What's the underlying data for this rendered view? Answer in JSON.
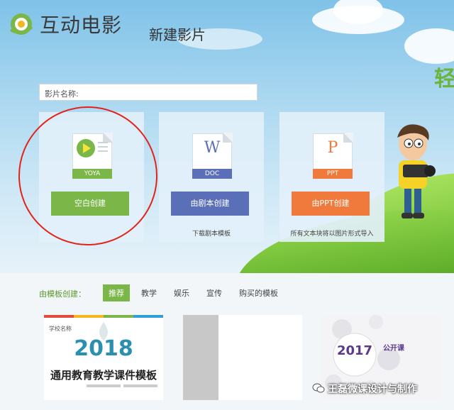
{
  "app": {
    "name": "互动电影",
    "page_title": "新建影片",
    "slogan_partial": "轻"
  },
  "form": {
    "movie_name_label": "影片名称:",
    "movie_name_value": ""
  },
  "cards": [
    {
      "file_type": "YOYA",
      "button": "空白创建",
      "caption": "",
      "color": "#7ab648"
    },
    {
      "file_type": "DOC",
      "file_letter": "W",
      "button": "由剧本创建",
      "caption": "下载剧本模板",
      "color": "#5b6fb8"
    },
    {
      "file_type": "PPT",
      "file_letter": "P",
      "button": "由PPT创建",
      "caption": "所有文本块将以图片形式导入",
      "color": "#f07a3c"
    }
  ],
  "templates": {
    "label": "由模板创建：",
    "tabs": [
      "推荐",
      "教学",
      "娱乐",
      "宣传",
      "购买的模板"
    ],
    "active_tab": "推荐",
    "items": [
      {
        "school": "学校名称",
        "year": "2018",
        "title": "通用教育教学课件模板"
      },
      {},
      {
        "year": "2017",
        "tag": "公开课"
      }
    ]
  },
  "watermark": "王磊微课设计与制作",
  "colors": {
    "accent_green": "#7ab648",
    "doc_blue": "#5b6fb8",
    "ppt_orange": "#f07a3c",
    "highlight_red": "#e2231a"
  }
}
